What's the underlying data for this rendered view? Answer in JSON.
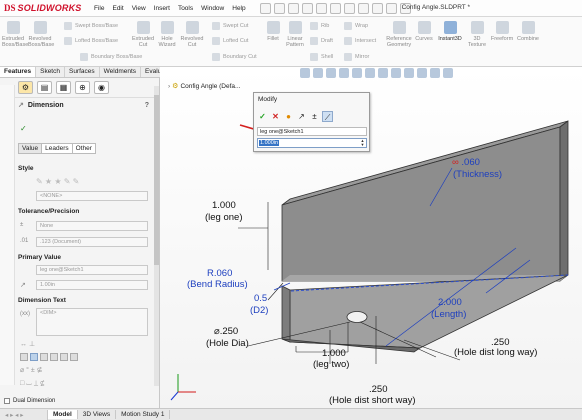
{
  "app": {
    "logo_ds": "DS",
    "logo_text": "SOLIDWORKS",
    "menus": [
      "File",
      "Edit",
      "View",
      "Insert",
      "Tools",
      "Window",
      "Help"
    ],
    "doc_title": "Config Angle.SLDPRT *"
  },
  "commands": {
    "extruded_boss": "Extruded Boss/Base",
    "revolved_boss": "Revolved Boss/Base",
    "swept_boss": "Swept Boss/Base",
    "lofted_boss": "Lofted Boss/Base",
    "boundary_boss": "Boundary Boss/Base",
    "extruded_cut": "Extruded Cut",
    "hole_wizard": "Hole Wizard",
    "revolved_cut": "Revolved Cut",
    "swept_cut": "Swept Cut",
    "lofted_cut": "Lofted Cut",
    "boundary_cut": "Boundary Cut",
    "fillet": "Fillet",
    "linear_pattern": "Linear Pattern",
    "rib": "Rib",
    "draft": "Draft",
    "shell": "Shell",
    "wrap": "Wrap",
    "intersect": "Intersect",
    "mirror": "Mirror",
    "reference_geometry": "Reference Geometry",
    "curves": "Curves",
    "instant3d": "Instant3D",
    "texture_3d": "3D Texture",
    "freeform": "Freeform",
    "combine": "Combine"
  },
  "tabs": [
    "Features",
    "Sketch",
    "Surfaces",
    "Weldments",
    "Evaluate"
  ],
  "panel": {
    "title": "Dimension",
    "subtabs": [
      "Value",
      "Leaders",
      "Other"
    ],
    "style_label": "Style",
    "style_value": "<NONE>",
    "tolerance_label": "Tolerance/Precision",
    "tolerance_value": "None",
    "precision_value": ".123 (Document)",
    "primary_label": "Primary Value",
    "primary_name": "leg one@Sketch1",
    "primary_value": "1.00in",
    "dimtext_label": "Dimension Text",
    "dimtext_value": "<DIM>",
    "dual_label": "Dual Dimension"
  },
  "tree": {
    "root": "Config Angle (Defa..."
  },
  "modify": {
    "title": "Modify",
    "name": "leg one@Sketch1",
    "value": "1.000in"
  },
  "dimensions": {
    "thickness_val": ".060",
    "thickness_name": "(Thickness)",
    "leg_one_val": "1.000",
    "leg_one_name": "(leg one)",
    "bend_val": "R.060",
    "bend_name": "(Bend Radius)",
    "d2_val": "0.5",
    "d2_name": "(D2)",
    "length_val": "2.000",
    "length_name": "(Length)",
    "hole_dia_val": "⌀.250",
    "hole_dia_name": "(Hole Dia)",
    "leg_two_val": "1.000",
    "leg_two_name": "(leg two)",
    "hole_long_val": ".250",
    "hole_long_name": "(Hole dist long way)",
    "hole_short_val": ".250",
    "hole_short_name": "(Hole dist short way)"
  },
  "bottom_tabs": [
    "Model",
    "3D Views",
    "Motion Study 1"
  ],
  "colors": {
    "brand": "#d0112b",
    "dimension_blue": "#1d3fbf",
    "part_gray": "#8a8a8a"
  }
}
